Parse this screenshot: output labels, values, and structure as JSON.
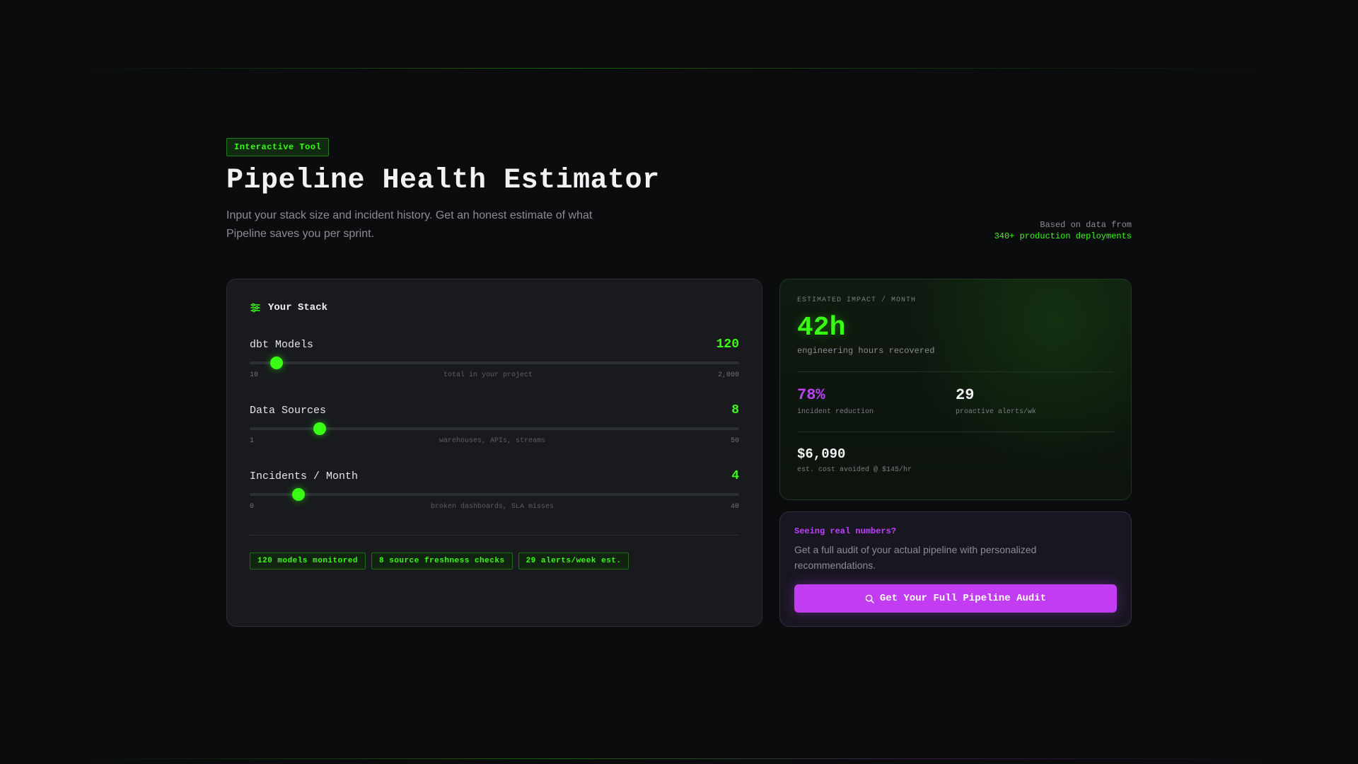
{
  "header": {
    "badge": "Interactive Tool",
    "title": "Pipeline Health Estimator",
    "subtitle": "Input your stack size and incident history. Get an honest estimate of what Pipeline saves you per sprint.",
    "source_line1": "Based on data from",
    "source_line2": "340+ production deployments"
  },
  "stack": {
    "title": "Your Stack",
    "icon": "sliders-icon",
    "sliders": [
      {
        "label": "dbt Models",
        "value": "120",
        "min": "10",
        "max": "2,000",
        "hint": "total in your project",
        "fraction": 0.055
      },
      {
        "label": "Data Sources",
        "value": "8",
        "min": "1",
        "max": "50",
        "hint": "warehouses, APIs, streams",
        "fraction": 0.143
      },
      {
        "label": "Incidents / Month",
        "value": "4",
        "min": "0",
        "max": "40",
        "hint": "broken dashboards, SLA misses",
        "fraction": 0.1
      }
    ],
    "chips": [
      "120 models monitored",
      "8 source freshness checks",
      "29 alerts/week est."
    ]
  },
  "impact": {
    "eyebrow": "ESTIMATED IMPACT / MONTH",
    "hours_value": "42h",
    "hours_label": "engineering hours recovered",
    "incident_value": "78%",
    "incident_label": "incident reduction",
    "alerts_value": "29",
    "alerts_label": "proactive alerts/wk",
    "cost_value": "$6,090",
    "cost_label": "est. cost avoided @ $145/hr"
  },
  "cta": {
    "title": "Seeing real numbers?",
    "text": "Get a full audit of your actual pipeline with personalized recommendations.",
    "button_label": "Get Your Full Pipeline Audit",
    "button_icon": "search-icon"
  },
  "colors": {
    "accent_green": "#39ff14",
    "accent_purple": "#bf40ff",
    "background": "#0b0c0e"
  }
}
